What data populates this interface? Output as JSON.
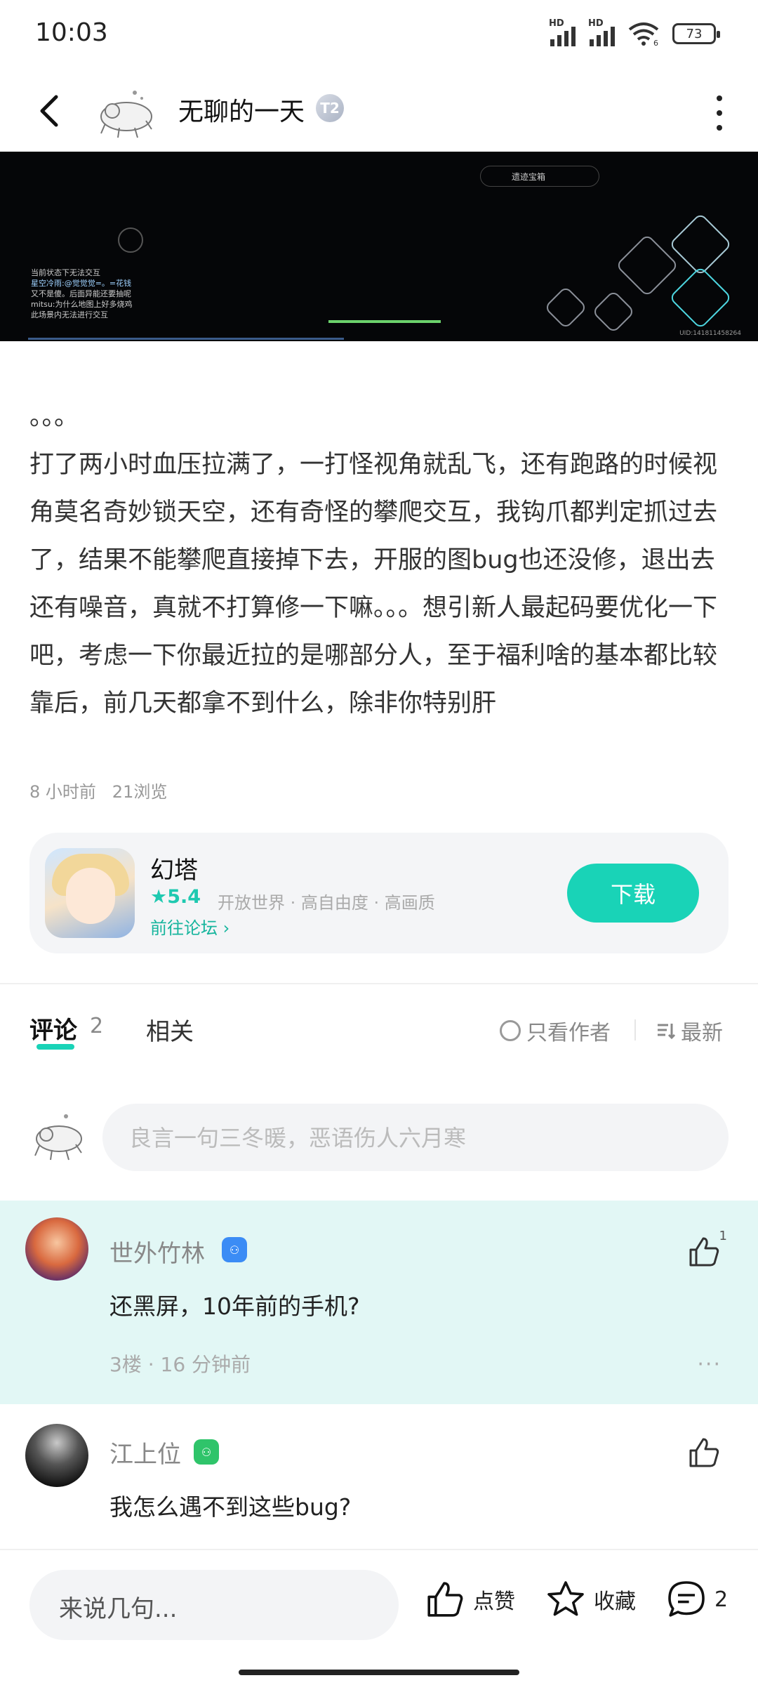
{
  "status_bar": {
    "time": "10:03",
    "battery": "73",
    "signal_label": "HD",
    "wifi_badge": "6"
  },
  "header": {
    "title": "无聊的一天",
    "level_badge": "T2"
  },
  "game_screenshot": {
    "quest_text": "遗迹宝箱",
    "chat_lines": [
      "当前状态下无法交互",
      "星空冷雨:@觉觉觉=。=花钱",
      "又不是傻。后面异能还要抽呢",
      "mitsu:为什么地图上好多烧鸡",
      "此场景内无法进行交互"
    ],
    "uid_text": "UID:141811458264"
  },
  "post": {
    "ellipsis_line": "。。。",
    "body": "打了两小时血压拉满了，一打怪视角就乱飞，还有跑路的时候视角莫名奇妙锁天空，还有奇怪的攀爬交互，我钩爪都判定抓过去了，结果不能攀爬直接掉下去，开服的图bug也还没修，退出去还有噪音，真就不打算修一下嘛。。。想引新人最起码要优化一下吧，考虑一下你最近拉的是哪部分人，至于福利啥的基本都比较靠后，前几天都拿不到什么，除非你特别肝",
    "time": "8 小时前",
    "views": "21浏览"
  },
  "app_card": {
    "name": "幻塔",
    "rating": "5.4",
    "tags": "开放世界 · 高自由度 · 高画质",
    "forum_link": "前往论坛",
    "download_label": "下载"
  },
  "comments_section": {
    "tab_comments": "评论",
    "comment_count": "2",
    "tab_related": "相关",
    "only_author": "只看作者",
    "sort": "最新",
    "input_placeholder": "良言一句三冬暖，恶语伤人六月寒"
  },
  "comments": [
    {
      "name": "世外竹林",
      "text": "还黑屏，10年前的手机?",
      "floor": "3楼",
      "time": "16 分钟前",
      "likes": "1"
    },
    {
      "name": "江上位",
      "text": "我怎么遇不到这些bug?"
    }
  ],
  "bottom_bar": {
    "input_placeholder": "来说几句...",
    "like_label": "点赞",
    "favorite_label": "收藏",
    "comment_count": "2"
  },
  "colors": {
    "accent": "#19d3b7",
    "highlight": "#e2f7f5"
  }
}
